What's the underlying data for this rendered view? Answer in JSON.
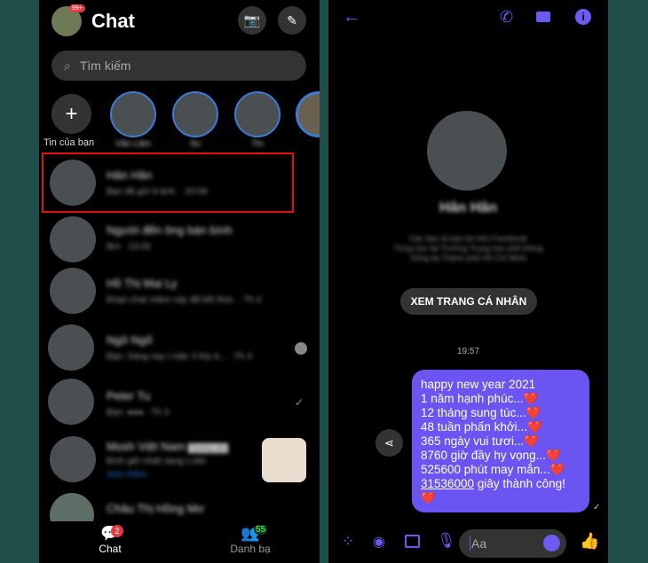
{
  "colors": {
    "accent": "#6b5bf0",
    "bubble": "#6b55f2",
    "highlight": "#e01010",
    "badge_red": "#e63946",
    "badge_green": "#2ea043"
  },
  "left": {
    "title": "Chat",
    "avatar_badge": "99+",
    "search_placeholder": "Tìm kiếm",
    "stories": [
      {
        "label": "Tin của bạn"
      },
      {
        "label": "Vân Lâm"
      },
      {
        "label": "Su"
      },
      {
        "label": "Tin"
      }
    ],
    "conversations": [
      {
        "name": "Hân Hân",
        "preview": "Bạn đã gửi 9 ảnh. · 20:08",
        "highlighted": true
      },
      {
        "name": "Người đến ông bán bình",
        "preview": "Bơi · 13:33"
      },
      {
        "name": "Hồ Thị Mai Ly",
        "preview": "Đoạn chat video này đã kết thúc. · Th 4"
      },
      {
        "name": "Ngô Ngố",
        "preview": "Bạn: Sáng nay t mặc 3 lớp á... · Th 4"
      },
      {
        "name": "Peter Tu",
        "preview": "Bạn: ●●● · Th 3"
      },
      {
        "name": "Mosh Việt Nam",
        "tag": "Quảng cáo",
        "preview": "Bình giữ nhiệt dạng Lotte",
        "link": "Xem thêm"
      },
      {
        "name": "Châu Thị Hồng Mơ",
        "preview": ""
      }
    ],
    "nav": [
      {
        "label": "Chat",
        "badge": "2"
      },
      {
        "label": "Danh bạ",
        "badge": "55"
      }
    ]
  },
  "right": {
    "profile_name": "Hân Hân",
    "profile_lines": [
      "Các bạn là bạn bè trên Facebook",
      "Từng học tại Trường Trung học phổ thông",
      "Sống tại Thành phố Hồ Chí Minh"
    ],
    "profile_button": "XEM TRANG CÁ NHÂN",
    "timestamp": "19:57",
    "message_lines": [
      "happy new year 2021",
      "1 năm hạnh phúc...❤️",
      "12 tháng sung túc...❤️",
      "48 tuần phấn khởi...❤️",
      "365 ngày vui tươi...❤️",
      "8760 giờ đầy hy vọng...❤️",
      "525600 phút may mắn...❤️"
    ],
    "message_last_number": "31536000",
    "message_last_rest": " giây thành công!",
    "message_end": "❤️",
    "input_placeholder": "Aa"
  }
}
